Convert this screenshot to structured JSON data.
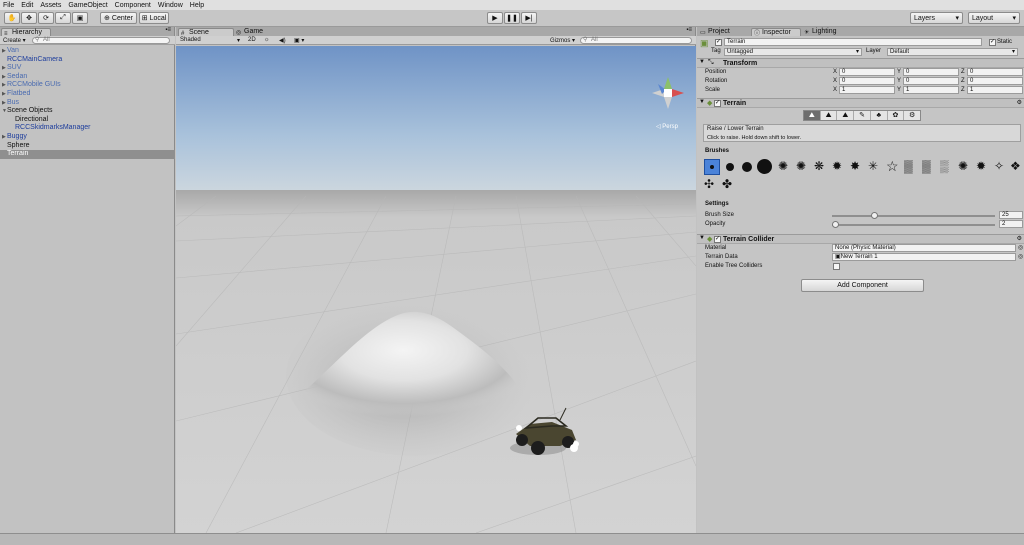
{
  "menu": [
    "File",
    "Edit",
    "Assets",
    "GameObject",
    "Component",
    "Window",
    "Help"
  ],
  "toolbar": {
    "pivot_label": "Center",
    "space_label": "Local",
    "layers_label": "Layers",
    "layout_label": "Layout"
  },
  "hierarchy": {
    "tab_label": "Hierarchy",
    "create_label": "Create",
    "search_placeholder": "All",
    "items": [
      {
        "label": "Van"
      },
      {
        "label": "RCCMainCamera"
      },
      {
        "label": "SUV"
      },
      {
        "label": "Sedan"
      },
      {
        "label": "RCCMobile GUIs"
      },
      {
        "label": "Flatbed"
      },
      {
        "label": "Bus"
      },
      {
        "label": "Scene Objects"
      },
      {
        "label": "Directional"
      },
      {
        "label": "RCCSkidmarksManager"
      },
      {
        "label": "Buggy"
      },
      {
        "label": "Sphere"
      },
      {
        "label": "Terrain"
      }
    ]
  },
  "scene": {
    "tab_scene": "Scene",
    "tab_game": "Game",
    "shading_mode": "Shaded",
    "mode_2d": "2D",
    "gizmos_label": "Gizmos",
    "search_placeholder": "All",
    "persp_label": "Persp"
  },
  "inspector": {
    "tab_project": "Project",
    "tab_inspector": "Inspector",
    "tab_lighting": "Lighting",
    "object_name": "Terrain",
    "static_label": "Static",
    "tag_label": "Tag",
    "tag_value": "Untagged",
    "layer_label": "Layer",
    "layer_value": "Default",
    "transform": {
      "title": "Transform",
      "rows": [
        {
          "label": "Position",
          "x": "0",
          "y": "0",
          "z": "0"
        },
        {
          "label": "Rotation",
          "x": "0",
          "y": "0",
          "z": "0"
        },
        {
          "label": "Scale",
          "x": "1",
          "y": "1",
          "z": "1"
        }
      ],
      "axis_x": "X",
      "axis_y": "Y",
      "axis_z": "Z"
    },
    "terrain": {
      "title": "Terrain",
      "tool_name": "Raise / Lower Terrain",
      "tool_hint": "Click to raise. Hold down shift to lower.",
      "brushes_label": "Brushes",
      "settings_label": "Settings",
      "brush_size_label": "Brush Size",
      "brush_size_value": "25",
      "brush_size_fraction": 0.26,
      "opacity_label": "Opacity",
      "opacity_value": "2",
      "opacity_fraction": 0.02
    },
    "collider": {
      "title": "Terrain Collider",
      "material_label": "Material",
      "material_value": "None (Physic Material)",
      "terrain_data_label": "Terrain Data",
      "terrain_data_value": "New Terrain 1",
      "tree_colliders_label": "Enable Tree Colliders"
    },
    "add_component_label": "Add Component"
  }
}
